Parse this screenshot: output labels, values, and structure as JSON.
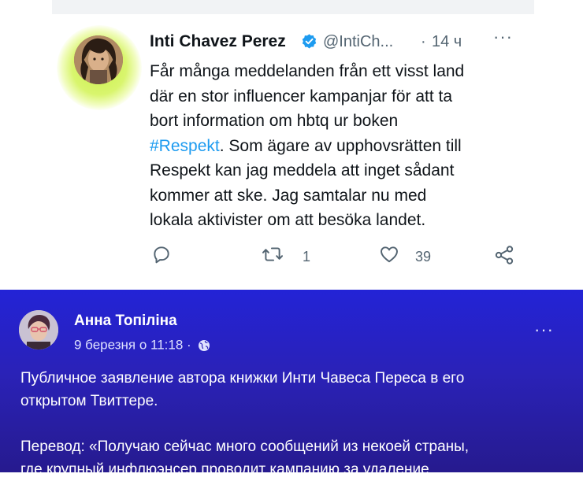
{
  "tweet": {
    "author_name": "Inti Chavez Perez",
    "handle": "@IntiCh...",
    "separator": "·",
    "time": "14 ч",
    "more": "···",
    "body_lines": [
      "Får många meddelanden från ett visst land",
      "där en stor influencer kampanjar för att ta",
      "bort information om hbtq ur boken"
    ],
    "hashtag": "#Respekt",
    "line4_rest": ". Som ägare av upphovsrätten till",
    "body_lines_after": [
      "Respekt kan jag meddela att inget sådant",
      "kommer att ske. Jag samtalar nu med",
      "lokala aktivister om att besöka landet."
    ],
    "retweet_count": "1",
    "like_count": "39",
    "colors": {
      "link": "#1d9bf0",
      "verified": "#1d9bf0",
      "glow": "#c8f04a"
    }
  },
  "post": {
    "author_name": "Анна Топіліна",
    "date": "9 березня о 11:18",
    "date_sep": "·",
    "more": "···",
    "paragraph1": [
      "Публичное заявление автора книжки Инти Чавеса Переса в его",
      "открытом Твиттере."
    ],
    "paragraph2": [
      "Перевод: «Получаю сейчас много сообщений из некоей страны,",
      "где крупный инфлюэнсер проводит кампанию за удаление"
    ],
    "colors": {
      "background_top": "#2323d6",
      "background_bottom": "#261a8e"
    }
  }
}
